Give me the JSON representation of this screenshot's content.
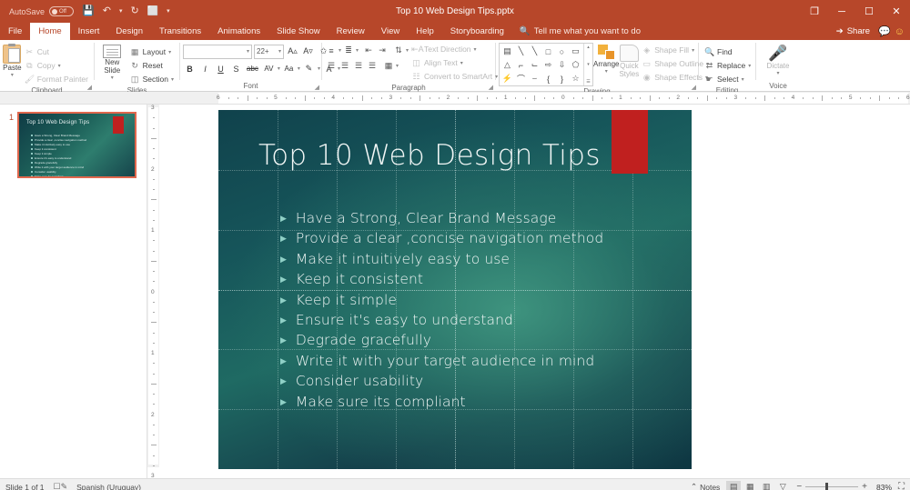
{
  "titlebar": {
    "autosave_label": "AutoSave",
    "autosave_state": "Off",
    "window_title": "Top 10 Web Design Tips.pptx",
    "qat": [
      {
        "name": "save",
        "glyph": "💾"
      },
      {
        "name": "undo",
        "glyph": "↶"
      },
      {
        "name": "redo",
        "glyph": "↻"
      },
      {
        "name": "start-slideshow",
        "glyph": "⬜"
      },
      {
        "name": "customize-qat",
        "glyph": "▾"
      }
    ],
    "window_controls": {
      "ribbon_display": "❐",
      "minimize": "─",
      "restore": "☐",
      "close": "✕"
    }
  },
  "tabs": [
    {
      "label": "File",
      "active": false
    },
    {
      "label": "Home",
      "active": true
    },
    {
      "label": "Insert",
      "active": false
    },
    {
      "label": "Design",
      "active": false
    },
    {
      "label": "Transitions",
      "active": false
    },
    {
      "label": "Animations",
      "active": false
    },
    {
      "label": "Slide Show",
      "active": false
    },
    {
      "label": "Review",
      "active": false
    },
    {
      "label": "View",
      "active": false
    },
    {
      "label": "Help",
      "active": false
    },
    {
      "label": "Storyboarding",
      "active": false
    }
  ],
  "tellme": "Tell me what you want to do",
  "share_label": "Share",
  "ribbon": {
    "clipboard": {
      "group_label": "Clipboard",
      "paste_label": "Paste",
      "items": [
        {
          "label": "Cut",
          "icon": "scissors-icon"
        },
        {
          "label": "Copy",
          "icon": "copy-icon"
        },
        {
          "label": "Format Painter",
          "icon": "format-painter-icon"
        }
      ]
    },
    "slides": {
      "group_label": "Slides",
      "new_slide_label": "New Slide",
      "items": [
        {
          "label": "Layout",
          "icon": "layout-icon"
        },
        {
          "label": "Reset",
          "icon": "reset-icon"
        },
        {
          "label": "Section",
          "icon": "section-icon"
        }
      ]
    },
    "font": {
      "group_label": "Font",
      "font_name": "",
      "font_size": "22+",
      "buttons": [
        "A▴",
        "A▾",
        "✐",
        "B",
        "I",
        "U",
        "S",
        "abc",
        "AV",
        "Aa",
        "✎",
        "A"
      ]
    },
    "paragraph": {
      "group_label": "Paragraph",
      "items": [
        {
          "label": "Text Direction",
          "icon": "text-direction-icon"
        },
        {
          "label": "Align Text",
          "icon": "align-text-icon"
        },
        {
          "label": "Convert to SmartArt",
          "icon": "smartart-icon"
        }
      ]
    },
    "drawing": {
      "group_label": "Drawing",
      "arrange_label": "Arrange",
      "quick_styles_label": "Quick Styles",
      "shapes": [
        "▤",
        "╲",
        "╲",
        "□",
        "○",
        "▭",
        "△",
        "⌐",
        "⌙",
        "⇨",
        "⇩",
        "⬠",
        "⚡",
        "⌒",
        "⌣",
        "{",
        "}",
        "☆"
      ],
      "items": [
        {
          "label": "Shape Fill",
          "icon": "shape-fill-icon"
        },
        {
          "label": "Shape Outline",
          "icon": "shape-outline-icon"
        },
        {
          "label": "Shape Effects",
          "icon": "shape-effects-icon"
        }
      ]
    },
    "editing": {
      "group_label": "Editing",
      "items": [
        {
          "label": "Find",
          "icon": "search-icon"
        },
        {
          "label": "Replace",
          "icon": "replace-icon"
        },
        {
          "label": "Select",
          "icon": "select-icon"
        }
      ]
    },
    "voice": {
      "group_label": "Voice",
      "dictate_label": "Dictate",
      "icon": "microphone-icon"
    }
  },
  "rulers": {
    "horizontal": [
      "6",
      "5",
      "4",
      "3",
      "2",
      "1",
      "0",
      "1",
      "2",
      "3",
      "4",
      "5",
      "6"
    ],
    "vertical": [
      "3",
      "2",
      "1",
      "0",
      "1",
      "2",
      "3"
    ]
  },
  "thumbnails": [
    {
      "number": "1",
      "title": "Top 10 Web Design Tips",
      "bullets": [
        "Have a Strong, Clear Brand Message",
        "Provide a clear ,concise navigation method",
        "Make it intuitively easy to use",
        "Keep it consistent",
        "Keep it simple",
        "Ensure it's easy to understand",
        "Degrade gracefully",
        "Write it with your target audience in mind",
        "Consider usability",
        "Make sure its compliant"
      ]
    }
  ],
  "slide": {
    "title": "Top 10 Web Design Tips",
    "bullet_glyph": "▶",
    "bullets": [
      "Have a Strong, Clear Brand Message",
      "Provide a clear ,concise navigation method",
      "Make it intuitively easy to use",
      "Keep it consistent",
      "Keep it simple",
      "Ensure it's easy to understand",
      "Degrade gracefully",
      "Write it with your target audience in mind",
      "Consider usability",
      "Make sure its compliant"
    ],
    "accent_color": "#c0201f",
    "background_dark": "#10424c",
    "background_light": "#409680"
  },
  "status": {
    "slide_counter": "Slide 1 of 1",
    "accessibility_icon": "accessibility-icon",
    "language": "Spanish (Uruguay)",
    "notes_label": "Notes",
    "views": [
      {
        "name": "normal-view",
        "glyph": "▤",
        "selected": true
      },
      {
        "name": "slide-sorter-view",
        "glyph": "▦",
        "selected": false
      },
      {
        "name": "reading-view",
        "glyph": "▥",
        "selected": false
      },
      {
        "name": "slideshow-view",
        "glyph": "▽",
        "selected": false
      }
    ],
    "zoom_out": "−",
    "zoom_in": "+",
    "zoom_value": "83%",
    "fit_icon": "fit-slide-icon"
  }
}
